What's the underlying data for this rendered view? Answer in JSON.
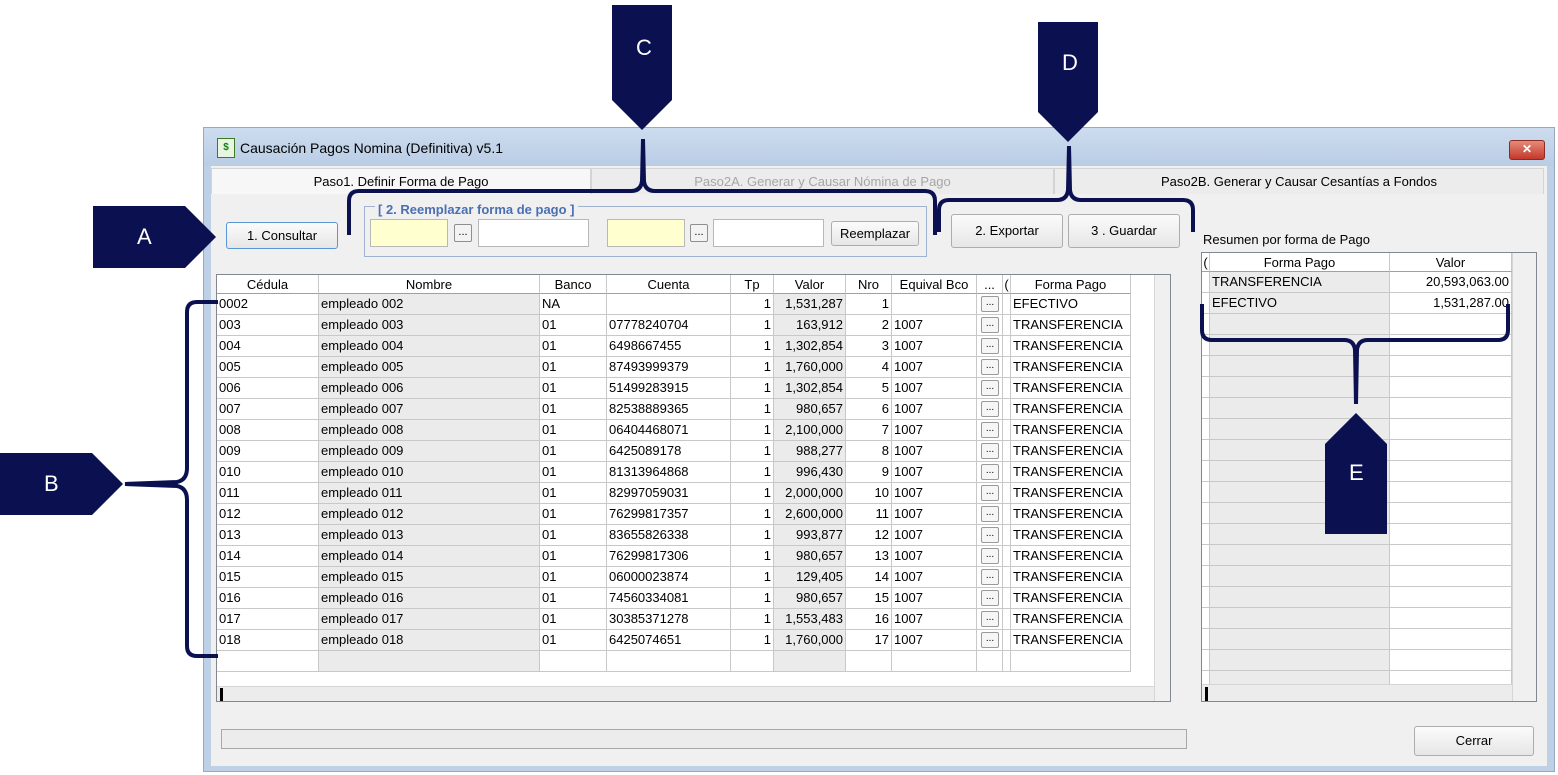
{
  "window": {
    "title": "Causación Pagos Nomina (Definitiva) v5.1",
    "close_label": "✕"
  },
  "tabs": [
    {
      "label": "Paso1. Definir Forma de Pago",
      "active": true
    },
    {
      "label": "Paso2A. Generar y Causar Nómina de Pago",
      "active": false
    },
    {
      "label": "Paso2B. Generar y Causar Cesantías a Fondos",
      "active": false
    }
  ],
  "toolbar": {
    "consultar_label": "1. Consultar",
    "replace_group_title": "[ 2. Reemplazar forma de pago ]",
    "dots_label": "...",
    "reemplazar_label": "Reemplazar",
    "exportar_label": "2. Exportar",
    "guardar_label": "3 . Guardar"
  },
  "grid": {
    "columns": [
      "Cédula",
      "Nombre",
      "Banco",
      "Cuenta",
      "Tp",
      "Valor",
      "Nro",
      "Equival Bco",
      "...",
      "(",
      "Forma Pago"
    ],
    "rows": [
      {
        "cedula": "0002",
        "nombre": "empleado 002",
        "banco": "NA",
        "cuenta": "",
        "tp": "1",
        "valor": "1,531,287",
        "nro": "1",
        "equival": "",
        "forma": "EFECTIVO"
      },
      {
        "cedula": "003",
        "nombre": "empleado 003",
        "banco": "01",
        "cuenta": "07778240704",
        "tp": "1",
        "valor": "163,912",
        "nro": "2",
        "equival": "1007",
        "forma": "TRANSFERENCIA"
      },
      {
        "cedula": "004",
        "nombre": "empleado 004",
        "banco": "01",
        "cuenta": "6498667455",
        "tp": "1",
        "valor": "1,302,854",
        "nro": "3",
        "equival": "1007",
        "forma": "TRANSFERENCIA"
      },
      {
        "cedula": "005",
        "nombre": "empleado 005",
        "banco": "01",
        "cuenta": "87493999379",
        "tp": "1",
        "valor": "1,760,000",
        "nro": "4",
        "equival": "1007",
        "forma": "TRANSFERENCIA"
      },
      {
        "cedula": "006",
        "nombre": "empleado 006",
        "banco": "01",
        "cuenta": "51499283915",
        "tp": "1",
        "valor": "1,302,854",
        "nro": "5",
        "equival": "1007",
        "forma": "TRANSFERENCIA"
      },
      {
        "cedula": "007",
        "nombre": "empleado 007",
        "banco": "01",
        "cuenta": "82538889365",
        "tp": "1",
        "valor": "980,657",
        "nro": "6",
        "equival": "1007",
        "forma": "TRANSFERENCIA"
      },
      {
        "cedula": "008",
        "nombre": "empleado 008",
        "banco": "01",
        "cuenta": "06404468071",
        "tp": "1",
        "valor": "2,100,000",
        "nro": "7",
        "equival": "1007",
        "forma": "TRANSFERENCIA"
      },
      {
        "cedula": "009",
        "nombre": "empleado 009",
        "banco": "01",
        "cuenta": "6425089178",
        "tp": "1",
        "valor": "988,277",
        "nro": "8",
        "equival": "1007",
        "forma": "TRANSFERENCIA"
      },
      {
        "cedula": "010",
        "nombre": "empleado 010",
        "banco": "01",
        "cuenta": "81313964868",
        "tp": "1",
        "valor": "996,430",
        "nro": "9",
        "equival": "1007",
        "forma": "TRANSFERENCIA"
      },
      {
        "cedula": "011",
        "nombre": "empleado 011",
        "banco": "01",
        "cuenta": "82997059031",
        "tp": "1",
        "valor": "2,000,000",
        "nro": "10",
        "equival": "1007",
        "forma": "TRANSFERENCIA"
      },
      {
        "cedula": "012",
        "nombre": "empleado 012",
        "banco": "01",
        "cuenta": "76299817357",
        "tp": "1",
        "valor": "2,600,000",
        "nro": "11",
        "equival": "1007",
        "forma": "TRANSFERENCIA"
      },
      {
        "cedula": "013",
        "nombre": "empleado 013",
        "banco": "01",
        "cuenta": "83655826338",
        "tp": "1",
        "valor": "993,877",
        "nro": "12",
        "equival": "1007",
        "forma": "TRANSFERENCIA"
      },
      {
        "cedula": "014",
        "nombre": "empleado 014",
        "banco": "01",
        "cuenta": "76299817306",
        "tp": "1",
        "valor": "980,657",
        "nro": "13",
        "equival": "1007",
        "forma": "TRANSFERENCIA"
      },
      {
        "cedula": "015",
        "nombre": "empleado 015",
        "banco": "01",
        "cuenta": "06000023874",
        "tp": "1",
        "valor": "129,405",
        "nro": "14",
        "equival": "1007",
        "forma": "TRANSFERENCIA"
      },
      {
        "cedula": "016",
        "nombre": "empleado 016",
        "banco": "01",
        "cuenta": "74560334081",
        "tp": "1",
        "valor": "980,657",
        "nro": "15",
        "equival": "1007",
        "forma": "TRANSFERENCIA"
      },
      {
        "cedula": "017",
        "nombre": "empleado 017",
        "banco": "01",
        "cuenta": "30385371278",
        "tp": "1",
        "valor": "1,553,483",
        "nro": "16",
        "equival": "1007",
        "forma": "TRANSFERENCIA"
      },
      {
        "cedula": "018",
        "nombre": "empleado 018",
        "banco": "01",
        "cuenta": "6425074651",
        "tp": "1",
        "valor": "1,760,000",
        "nro": "17",
        "equival": "1007",
        "forma": "TRANSFERENCIA"
      }
    ]
  },
  "summary": {
    "title": "Resumen por forma de Pago",
    "columns": [
      "(",
      "Forma Pago",
      "Valor"
    ],
    "rows": [
      {
        "forma": "TRANSFERENCIA",
        "valor": "20,593,063.00"
      },
      {
        "forma": "EFECTIVO",
        "valor": "1,531,287.00"
      }
    ]
  },
  "footer": {
    "cerrar_label": "Cerrar"
  },
  "callouts": {
    "a": "A",
    "b": "B",
    "c": "C",
    "d": "D",
    "e": "E"
  },
  "colors": {
    "callout": "#0b1150",
    "input_yellow": "#ffffcf",
    "group_title": "#4a6fb3"
  }
}
